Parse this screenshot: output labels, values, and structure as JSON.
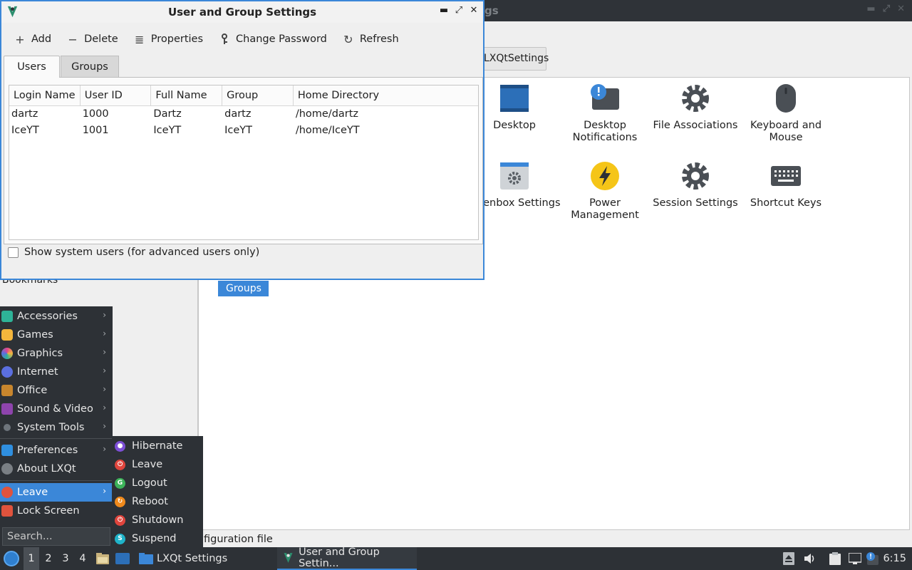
{
  "background_window": {
    "title_fragment": "gs",
    "search_tab_label": "LXQtSettings",
    "items": [
      {
        "label": "Desktop",
        "icon": "desktop-icon"
      },
      {
        "label": "Desktop Notifications",
        "icon": "notification-icon"
      },
      {
        "label": "File Associations",
        "icon": "gear-icon"
      },
      {
        "label": "Keyboard and Mouse",
        "icon": "mouse-icon"
      },
      {
        "label": "Openbox Settings",
        "icon": "window-settings-icon"
      },
      {
        "label": "Power Management",
        "icon": "lightning-icon"
      },
      {
        "label": "Session Settings",
        "icon": "gear-icon"
      },
      {
        "label": "Shortcut Keys",
        "icon": "keyboard-icon"
      }
    ],
    "selected_group_label": "Groups",
    "bookmarks_label": "Bookmarks",
    "status_text": "figuration file"
  },
  "dialog": {
    "title": "User and Group Settings",
    "toolbar": {
      "add": "Add",
      "delete": "Delete",
      "properties": "Properties",
      "change_password": "Change Password",
      "refresh": "Refresh"
    },
    "tabs": {
      "users": "Users",
      "groups": "Groups"
    },
    "columns": [
      "Login Name",
      "User ID",
      "Full Name",
      "Group",
      "Home Directory"
    ],
    "rows": [
      [
        "dartz",
        "1000",
        "Dartz",
        "dartz",
        "/home/dartz"
      ],
      [
        "IceYT",
        "1001",
        "IceYT",
        "IceYT",
        "/home/IceYT"
      ]
    ],
    "show_system_users_label": "Show system users (for advanced users only)",
    "show_system_users_checked": false
  },
  "menu": {
    "items": [
      {
        "label": "Accessories",
        "color": "#2eb398"
      },
      {
        "label": "Games",
        "color": "#f4b63c"
      },
      {
        "label": "Graphics",
        "color": "#e0458e"
      },
      {
        "label": "Internet",
        "color": "#5b6fe0"
      },
      {
        "label": "Office",
        "color": "#c8862d"
      },
      {
        "label": "Sound & Video",
        "color": "#8e44ad"
      },
      {
        "label": "System Tools",
        "color": "#6e757c"
      },
      {
        "label": "Preferences",
        "color": "#2f8fe0"
      },
      {
        "label": "About LXQt",
        "color": "#7a7f84"
      },
      {
        "label": "Leave",
        "color": "#e0533d"
      },
      {
        "label": "Lock Screen",
        "color": "#e0533d"
      }
    ],
    "search_placeholder": "Search...",
    "leave_submenu": [
      {
        "label": "Hibernate",
        "color": "#7d4fd6"
      },
      {
        "label": "Leave",
        "color": "#e0453d"
      },
      {
        "label": "Logout",
        "color": "#3db35a"
      },
      {
        "label": "Reboot",
        "color": "#f08a1c"
      },
      {
        "label": "Shutdown",
        "color": "#e0453d"
      },
      {
        "label": "Suspend",
        "color": "#1fb3c9"
      }
    ]
  },
  "taskbar": {
    "workspaces": [
      "1",
      "2",
      "3",
      "4"
    ],
    "tasks": [
      {
        "label": "LXQt Settings"
      },
      {
        "label": "User and Group Settin..."
      }
    ],
    "clock": "6:15"
  }
}
